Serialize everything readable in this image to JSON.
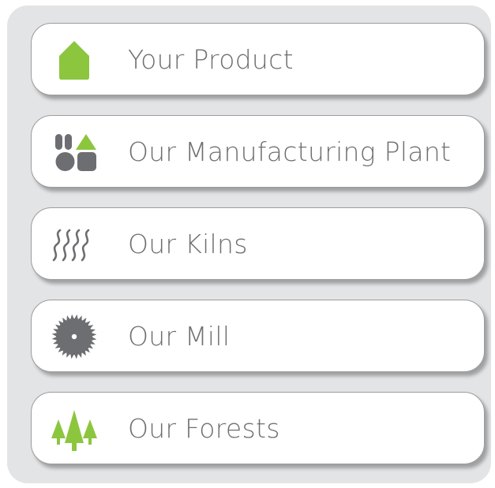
{
  "menu": {
    "items": [
      {
        "label": "Your Product",
        "icon": "house-icon",
        "icon_color": "#8cc63f"
      },
      {
        "label": "Our Manufacturing Plant",
        "icon": "building-blocks-icon",
        "icon_colors": [
          "#6d6e71",
          "#8cc63f"
        ]
      },
      {
        "label": "Our Kilns",
        "icon": "heat-waves-icon",
        "icon_color": "#6d6e71"
      },
      {
        "label": "Our Mill",
        "icon": "saw-blade-icon",
        "icon_color": "#6d6e71"
      },
      {
        "label": "Our Forests",
        "icon": "trees-icon",
        "icon_color": "#8cc63f"
      }
    ]
  },
  "colors": {
    "panel_background": "#e3e4e6",
    "item_background": "#ffffff",
    "text": "#6f6f6f",
    "accent_green": "#8cc63f",
    "icon_gray": "#6d6e71"
  }
}
